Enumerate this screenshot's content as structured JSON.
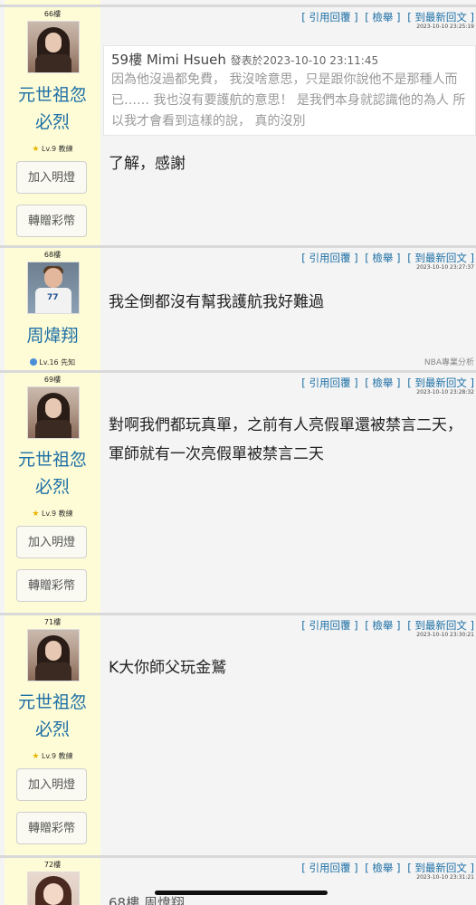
{
  "common": {
    "actions": {
      "quote": "[ 引用回覆 ]",
      "report": "[ 檢舉 ]",
      "latest": "[ 到最新回文 ]"
    },
    "side_buttons": {
      "light": "加入明燈",
      "gift": "轉贈彩幣"
    }
  },
  "posts": [
    {
      "floor": "66樓",
      "user": "元世祖忽\n必烈",
      "level": "Lv.9 教練",
      "time": "2023-10-10 23:25:19",
      "quote": {
        "header": "59樓 Mimi Hsueh",
        "meta": "發表於2023-10-10 23:11:45",
        "text": "因為他沒過都免費， 我沒啥意思，只是跟你說他不是那種人而已…… 我也沒有要護航的意思！ 是我們本身就認識他的為人 所以我才會看到這樣的說， 真的沒別"
      },
      "content": "了解，感謝"
    },
    {
      "floor": "68樓",
      "user": "周煒翔",
      "level": "Lv.16 先知",
      "time": "2023-10-10 23:27:37",
      "content": "我全倒都沒有幫我護航我好難過",
      "tag": "NBA專業分析"
    },
    {
      "floor": "69樓",
      "user": "元世祖忽\n必烈",
      "level": "Lv.9 教練",
      "time": "2023-10-10 23:28:32",
      "content": "對啊我們都玩真單，之前有人亮假單還被禁言二天，軍師就有一次亮假單被禁言二天"
    },
    {
      "floor": "71樓",
      "user": "元世祖忽\n必烈",
      "level": "Lv.9 教練",
      "time": "2023-10-10 23:30:21",
      "content": "K大你師父玩金鷲"
    },
    {
      "floor": "72樓",
      "time": "2023-10-10 23:31:21",
      "quote_header": "68樓 周煒翔"
    }
  ]
}
